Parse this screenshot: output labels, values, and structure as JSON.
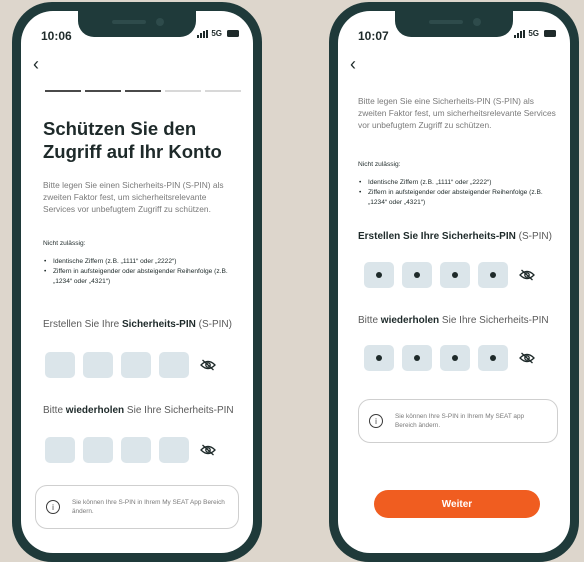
{
  "left": {
    "time": "10:06",
    "network": "5G",
    "title": "Schützen Sie den Zugriff auf Ihr Konto",
    "intro": "Bitte legen Sie einen Sicherheits-PIN (S-PIN) als zweiten Faktor fest, um sicherheitsrelevante Services vor unbefugtem Zugriff zu schützen.",
    "not_allowed_label": "Nicht zulässig:",
    "rules": [
      "Identische Ziffern (z.B. „1111“ oder „2222“)",
      "Ziffern in aufsteigender oder absteigender Reihenfolge (z.B. „1234“ oder „4321“)"
    ],
    "create_pin": {
      "pre": "Erstellen Sie Ihre ",
      "bold": "Sicherheits-PIN",
      "post": " (S-PIN)"
    },
    "repeat_pin": {
      "pre": "Bitte ",
      "bold": "wiederholen",
      "post": " Sie Ihre Sicherheits-PIN"
    },
    "info_text": "Sie können Ihre S-PIN in Ihrem My SEAT App Bereich ändern."
  },
  "right": {
    "time": "10:07",
    "network": "5G",
    "intro": "Bitte legen Sie eine Sicherheits-PIN (S-PIN) als zweiten Faktor fest, um sicherheitsrelevante Services vor unbefugtem Zugriff zu schützen.",
    "not_allowed_label": "Nicht zulässig:",
    "rules": [
      "Identische Ziffern (z.B. „1111“ oder „2222“)",
      "Ziffern in aufsteigender oder absteigender Reihenfolge (z.B. „1234“ oder „4321“)"
    ],
    "create_pin": {
      "pre": "",
      "bold": "Erstellen Sie Ihre Sicherheits-PIN",
      "post": " (S-PIN)"
    },
    "repeat_pin": {
      "pre": "Bitte ",
      "bold": "wiederholen",
      "post": " Sie Ihre Sicherheits-PIN"
    },
    "info_text": "Sie können Ihre S-PIN in Ihrem My SEAT app Bereich ändern.",
    "button_label": "Weiter"
  },
  "icons": {
    "back": "chevron-left-icon",
    "visibility": "eye-off-icon",
    "info": "info-icon"
  },
  "colors": {
    "accent": "#f05d20",
    "phone_frame": "#1f3a3a",
    "background": "#ddd6cc",
    "pin_box": "#dbe5ea"
  },
  "progress": {
    "steps_total": 5,
    "steps_done": 3
  }
}
